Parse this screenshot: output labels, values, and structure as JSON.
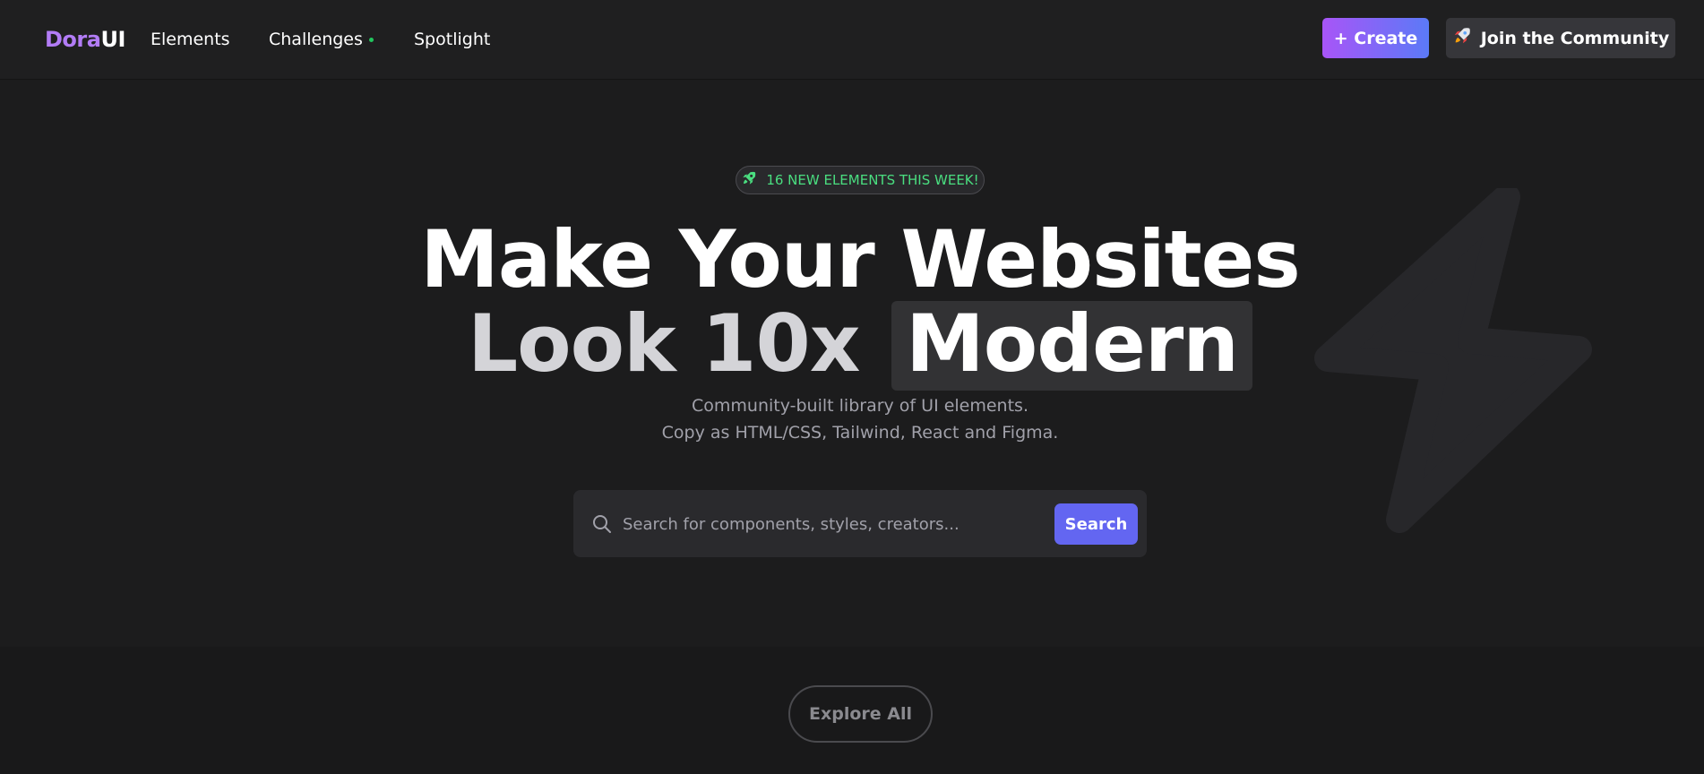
{
  "nav": {
    "logo_part1": "Dora",
    "logo_part2": "UI",
    "links": [
      "Elements",
      "Challenges",
      "Spotlight"
    ],
    "create_label": "+ Create",
    "join_label": "Join the Community"
  },
  "hero": {
    "badge": "16 NEW ELEMENTS THIS WEEK!",
    "title_line1": "Make Your Websites",
    "title_line2_prefix": "Look 10x",
    "title_line2_highlight": "Modern",
    "subtitle_line1": "Community-built library of UI elements.",
    "subtitle_line2": "Copy as HTML/CSS, Tailwind, React and Figma."
  },
  "search": {
    "placeholder": "Search for components, styles, creators...",
    "button_label": "Search"
  },
  "explore_label": "Explore All",
  "colors": {
    "background": "#1c1c1d",
    "accent_purple": "#a855f7",
    "accent_indigo": "#6366f1",
    "badge_green": "#4ade80"
  },
  "icons": [
    "rocket-icon",
    "search-icon",
    "lightning-bolt-icon"
  ]
}
